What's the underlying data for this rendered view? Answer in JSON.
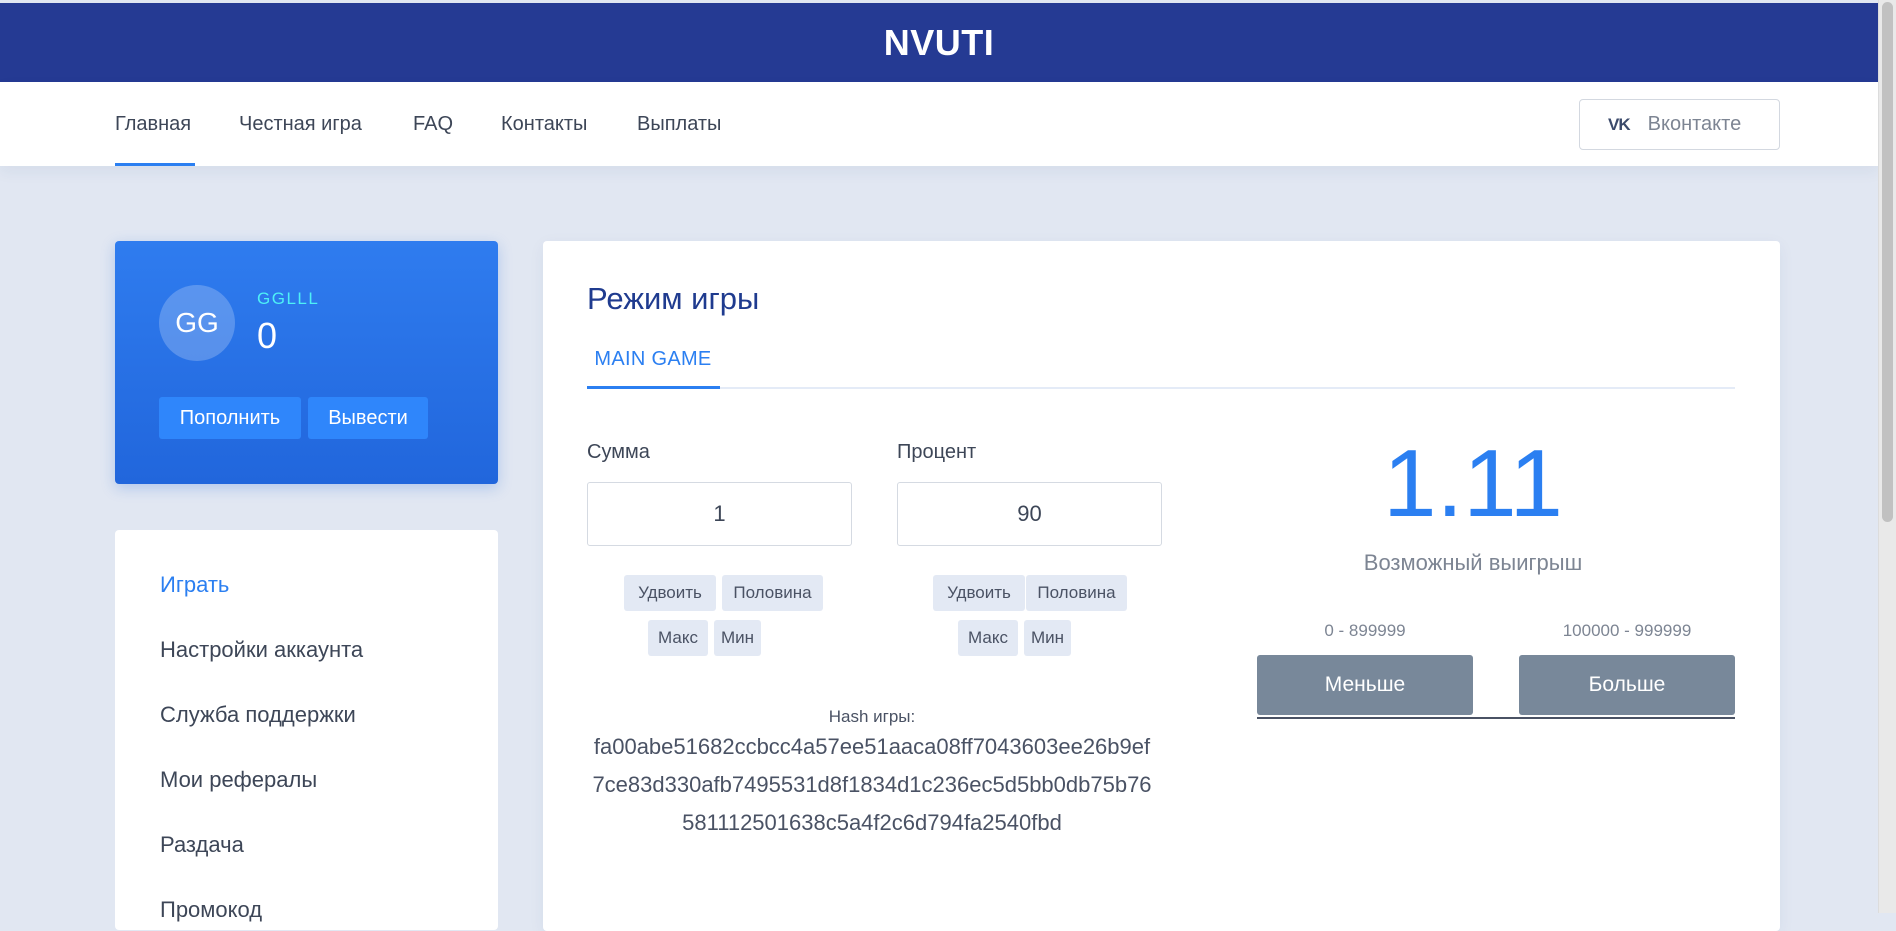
{
  "header": {
    "brand": "NVUTI"
  },
  "nav": {
    "links": [
      "Главная",
      "Честная игра",
      "FAQ",
      "Контакты",
      "Выплаты"
    ],
    "active_index": 0,
    "vk_icon": "vk-icon",
    "vk_label": "Вконтакте"
  },
  "profile": {
    "initials": "GG",
    "username": "GGLLL",
    "balance": "0",
    "deposit_label": "Пополнить",
    "withdraw_label": "Вывести"
  },
  "side_menu": {
    "items": [
      "Играть",
      "Настройки аккаунта",
      "Служба поддержки",
      "Мои рефералы",
      "Раздача",
      "Промокод"
    ],
    "active_index": 0
  },
  "game": {
    "title": "Режим игры",
    "tab": "MAIN GAME",
    "amount": {
      "label": "Сумма",
      "value": "1",
      "double_label": "Удвоить",
      "half_label": "Половина",
      "max_label": "Макс",
      "min_label": "Мин"
    },
    "percent": {
      "label": "Процент",
      "value": "90",
      "double_label": "Удвоить",
      "half_label": "Половина",
      "max_label": "Макс",
      "min_label": "Мин"
    },
    "hash_label": "Hash игры:",
    "hash_lines": [
      "fa00abe51682ccbcc4a57ee51aaca08ff7043603ee26b9ef",
      "7ce83d330afb7495531d8f1834d1c236ec5d5bb0db75b76",
      "581112501638c5a4f2c6d794fa2540fbd"
    ],
    "payout": "1.11",
    "payout_label": "Возможный выигрыш",
    "less": {
      "range": "0 - 899999",
      "label": "Меньше"
    },
    "more": {
      "range": "100000 - 999999",
      "label": "Больше"
    }
  },
  "colors": {
    "header_bg": "#253a93",
    "accent": "#2b7ff1",
    "bet_button": "#78889a",
    "username": "#4ef0f6"
  }
}
